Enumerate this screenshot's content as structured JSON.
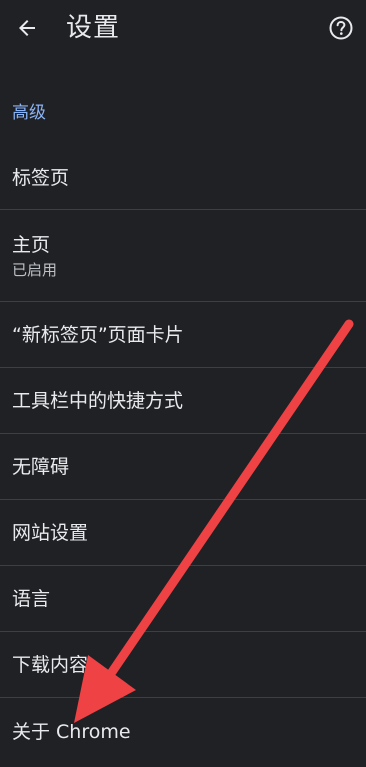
{
  "header": {
    "title": "设置",
    "back_icon": "arrow-left-icon",
    "help_icon": "help-circle-icon"
  },
  "section": {
    "title": "高级"
  },
  "items": [
    {
      "label": "标签页"
    },
    {
      "label": "主页",
      "subtitle": "已启用"
    },
    {
      "label": "“新标签页”页面卡片"
    },
    {
      "label": "工具栏中的快捷方式"
    },
    {
      "label": "无障碍"
    },
    {
      "label": "网站设置"
    },
    {
      "label": "语言"
    },
    {
      "label": "下载内容"
    },
    {
      "label": "关于 Chrome"
    }
  ],
  "colors": {
    "background": "#202124",
    "text": "#e8eaed",
    "accent": "#8ab4f8",
    "divider": "#3c4043",
    "annotation_arrow": "#ee4245"
  }
}
